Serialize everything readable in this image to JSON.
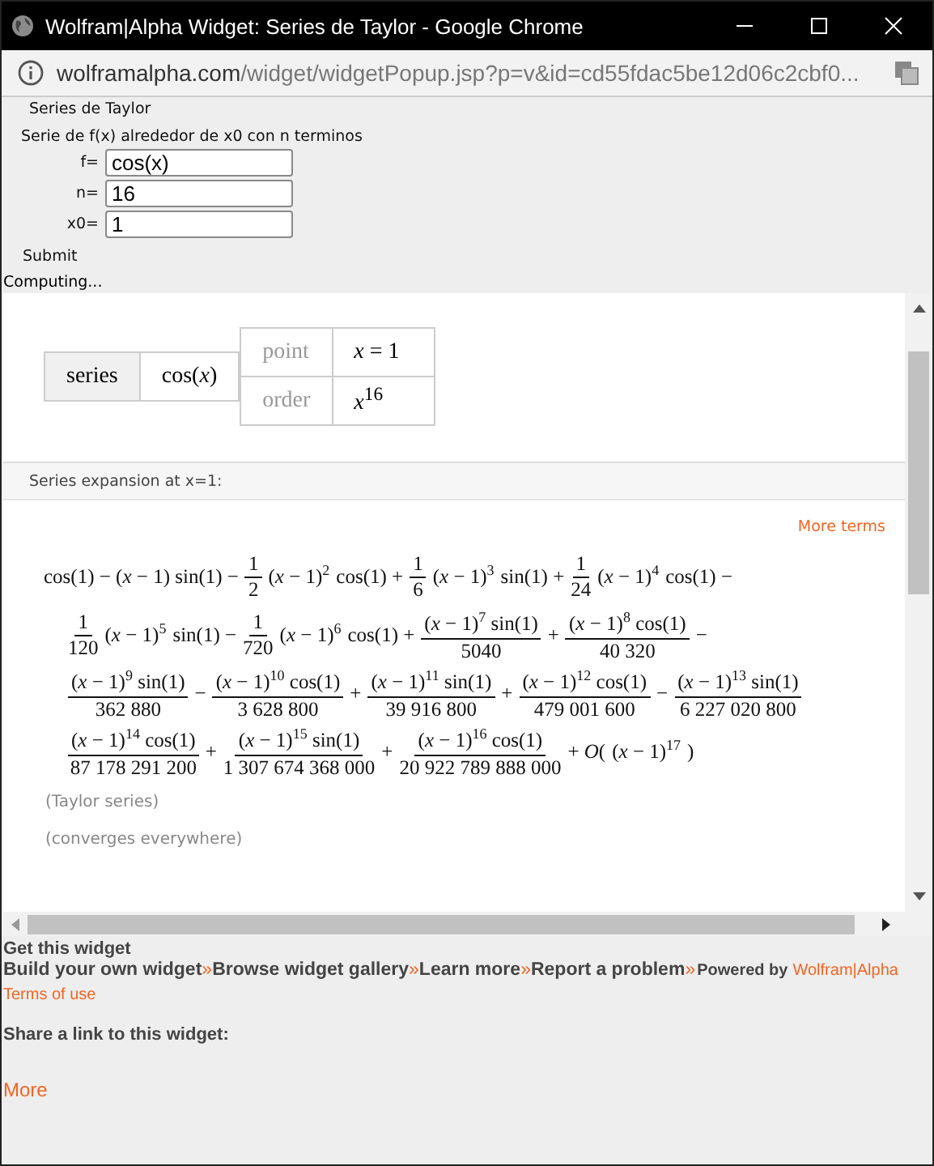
{
  "window": {
    "title": "Wolfram|Alpha Widget: Series de Taylor - Google Chrome"
  },
  "address_bar": {
    "domain": "wolframalpha.com",
    "path": "/widget/widgetPopup.jsp?p=v&id=cd55fdac5be12d06c2cbf0..."
  },
  "form": {
    "title": "Series de Taylor",
    "description": "Serie de f(x) alrededor de x0 con n terminos",
    "fields": [
      {
        "label": "f=",
        "value": "cos(x)"
      },
      {
        "label": "n=",
        "value": "16"
      },
      {
        "label": "x0=",
        "value": "1"
      }
    ],
    "submit": "Submit",
    "status": "Computing..."
  },
  "input_pod": {
    "header": "series",
    "function": "cos(*x*)",
    "params": [
      {
        "label": "point",
        "value": "*x* = 1"
      },
      {
        "label": "order",
        "value": "*x*$^{16}$"
      }
    ]
  },
  "result_pod": {
    "title": "Series expansion at x=1:",
    "more": "More terms",
    "lines": [
      [
        {
          "kind": "text",
          "text": "cos(1) − (*x* − 1) sin(1) −"
        },
        {
          "kind": "coef",
          "num": "1",
          "den": "2"
        },
        {
          "kind": "pow",
          "base": "(*x* − 1)",
          "exp": "2"
        },
        {
          "kind": "text",
          "text": "cos(1) +"
        },
        {
          "kind": "coef",
          "num": "1",
          "den": "6"
        },
        {
          "kind": "pow",
          "base": "(*x* − 1)",
          "exp": "3"
        },
        {
          "kind": "text",
          "text": "sin(1) +"
        },
        {
          "kind": "coef",
          "num": "1",
          "den": "24"
        },
        {
          "kind": "pow",
          "base": "(*x* − 1)",
          "exp": "4"
        },
        {
          "kind": "text",
          "text": "cos(1) −"
        }
      ],
      [
        {
          "kind": "coef",
          "num": "1",
          "den": "120"
        },
        {
          "kind": "pow",
          "base": "(*x* − 1)",
          "exp": "5"
        },
        {
          "kind": "text",
          "text": "sin(1) −"
        },
        {
          "kind": "coef",
          "num": "1",
          "den": "720"
        },
        {
          "kind": "pow",
          "base": "(*x* − 1)",
          "exp": "6"
        },
        {
          "kind": "text",
          "text": "cos(1) +"
        },
        {
          "kind": "frac",
          "base": "(*x* − 1)",
          "exp": "7",
          "tail": "sin(1)",
          "den": "5040"
        },
        {
          "kind": "text",
          "text": "+"
        },
        {
          "kind": "frac",
          "base": "(*x* − 1)",
          "exp": "8",
          "tail": "cos(1)",
          "den": "40 320"
        },
        {
          "kind": "text",
          "text": "−"
        }
      ],
      [
        {
          "kind": "frac",
          "base": "(*x* − 1)",
          "exp": "9",
          "tail": "sin(1)",
          "den": "362 880"
        },
        {
          "kind": "text",
          "text": "−"
        },
        {
          "kind": "frac",
          "base": "(*x* − 1)",
          "exp": "10",
          "tail": "cos(1)",
          "den": "3 628 800"
        },
        {
          "kind": "text",
          "text": "+"
        },
        {
          "kind": "frac",
          "base": "(*x* − 1)",
          "exp": "11",
          "tail": "sin(1)",
          "den": "39 916 800"
        },
        {
          "kind": "text",
          "text": "+"
        },
        {
          "kind": "frac",
          "base": "(*x* − 1)",
          "exp": "12",
          "tail": "cos(1)",
          "den": "479 001 600"
        },
        {
          "kind": "text",
          "text": "−"
        },
        {
          "kind": "frac",
          "base": "(*x* − 1)",
          "exp": "13",
          "tail": "sin(1)",
          "den": "6 227 020 800"
        }
      ],
      [
        {
          "kind": "frac",
          "base": "(*x* − 1)",
          "exp": "14",
          "tail": "cos(1)",
          "den": "87 178 291 200"
        },
        {
          "kind": "text",
          "text": "+"
        },
        {
          "kind": "frac",
          "base": "(*x* − 1)",
          "exp": "15",
          "tail": "sin(1)",
          "den": "1 307 674 368 000"
        },
        {
          "kind": "text",
          "text": "+"
        },
        {
          "kind": "frac",
          "base": "(*x* − 1)",
          "exp": "16",
          "tail": "cos(1)",
          "den": "20 922 789 888 000"
        },
        {
          "kind": "text",
          "text": "+ *O*("
        },
        {
          "kind": "pow",
          "base": "(*x* − 1)",
          "exp": "17"
        },
        {
          "kind": "text",
          "text": ")"
        }
      ]
    ],
    "notes": [
      "(Taylor series)",
      "(converges everywhere)"
    ]
  },
  "footer": {
    "heading": "Get this widget",
    "links": [
      "Build your own widget",
      "Browse widget gallery",
      "Learn more",
      "Report a problem"
    ],
    "separator": "»",
    "powered_label": "Powered by",
    "powered_link": "Wolfram|Alpha",
    "terms": "Terms of use",
    "share": "Share a link to this widget:",
    "more": "More"
  }
}
